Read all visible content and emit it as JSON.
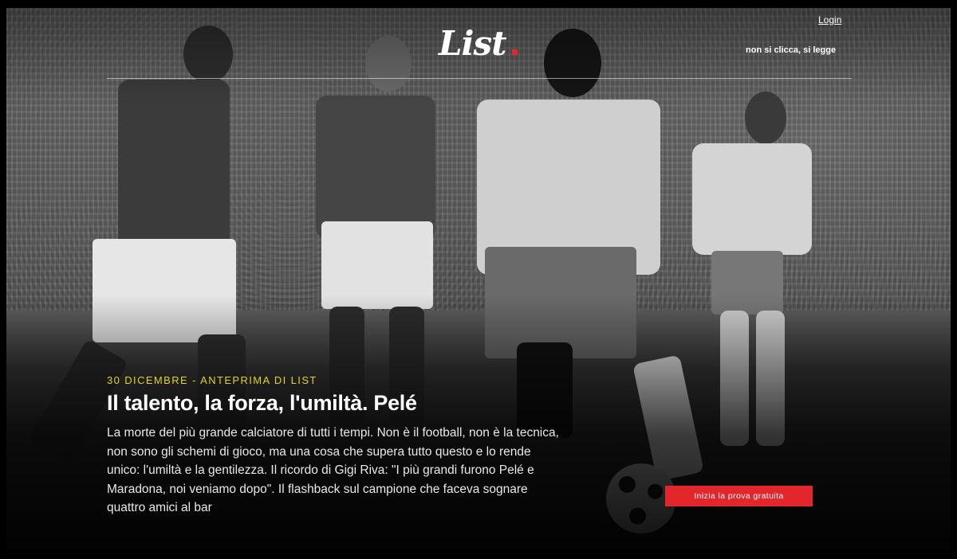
{
  "header": {
    "login_label": "Login",
    "logo_text": "List",
    "tagline": "non si clicca, si legge"
  },
  "hero": {
    "kicker": "30 DICEMBRE - ANTEPRIMA DI LIST",
    "headline": "Il talento, la forza, l'umiltà. Pelé",
    "summary": "La morte del più grande calciatore di tutti i tempi. Non è il football, non è la tecnica, non sono gli schemi di gioco, ma una cosa che supera tutto questo e lo rende unico: l'umiltà e la gentilezza. Il ricordo di Gigi Riva: \"I più grandi furono Pelé e Maradona, noi veniamo dopo\". Il flashback sul campione che faceva sognare quattro amici al bar",
    "cta_label": "Inizia la prova gratuita"
  },
  "colors": {
    "accent": "#e3262b",
    "kicker": "#e4d21b",
    "text": "#ffffff"
  }
}
